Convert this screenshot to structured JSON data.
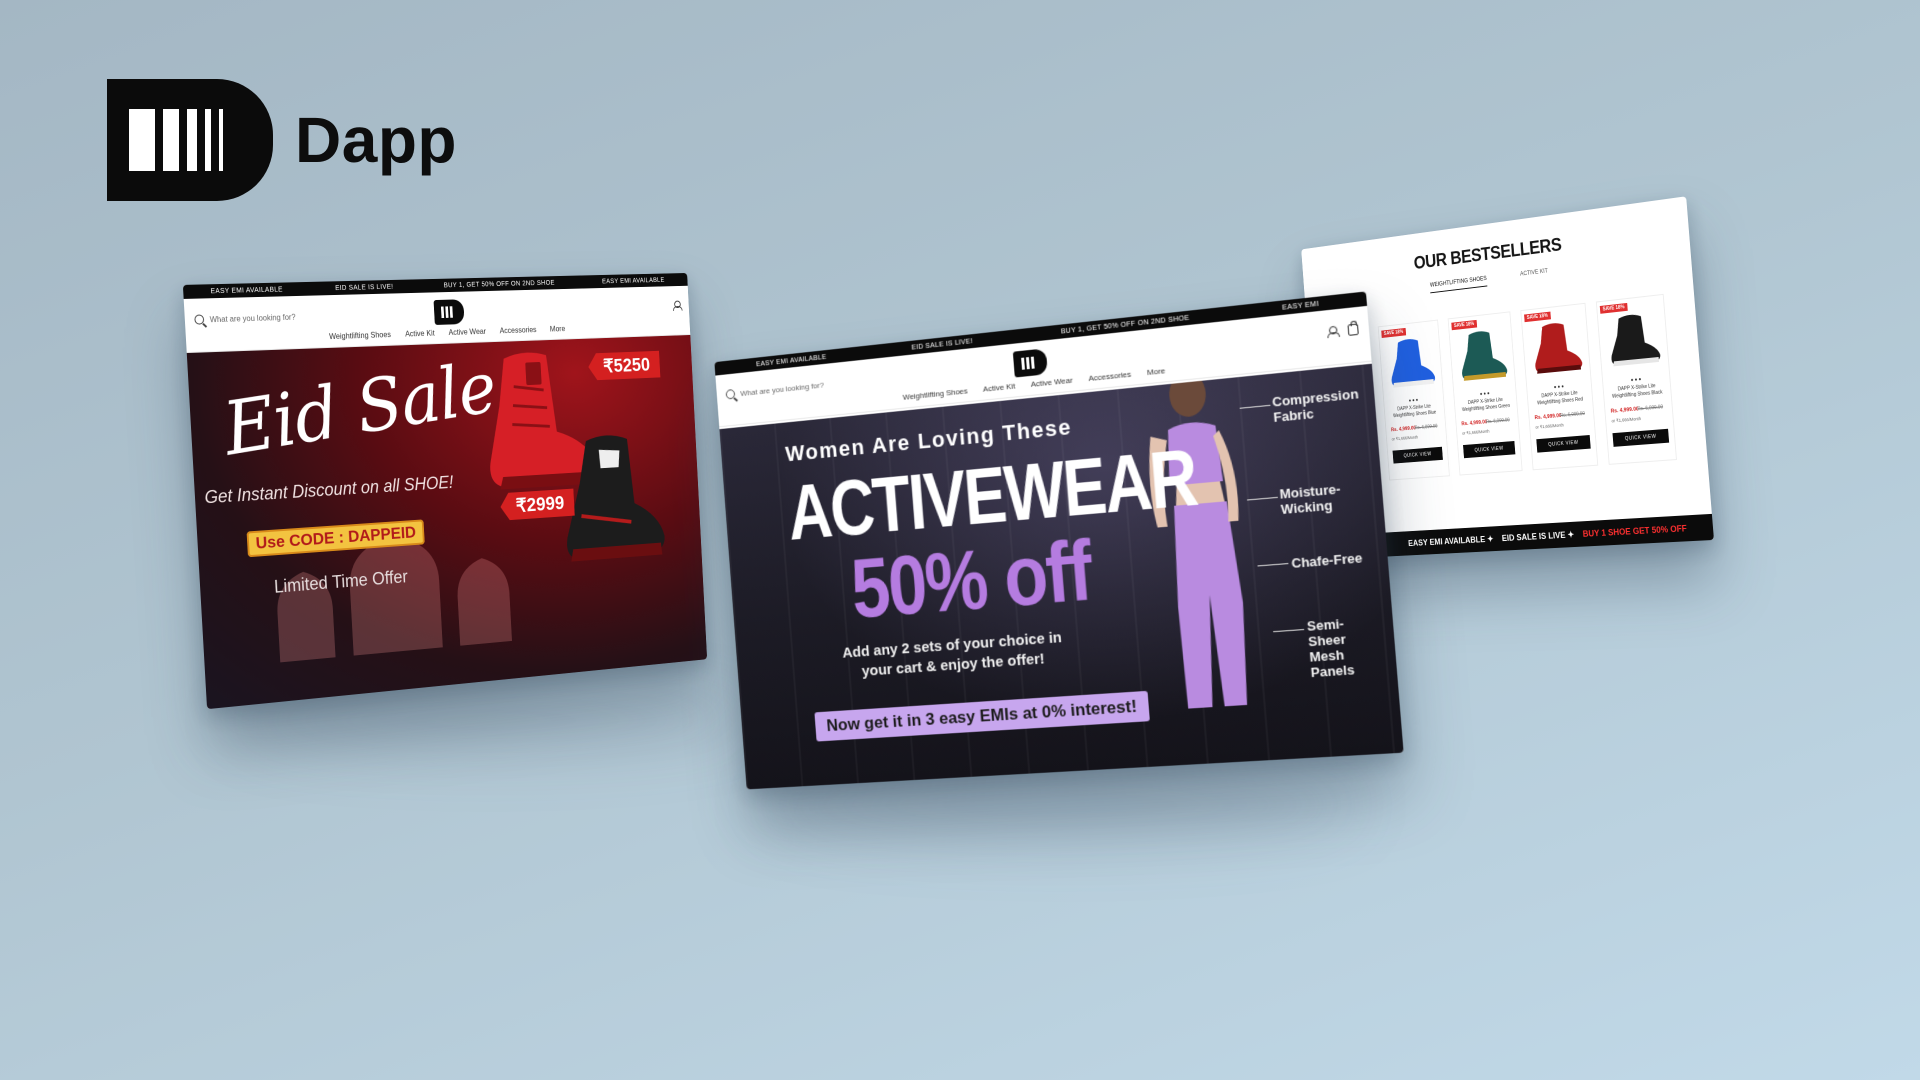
{
  "brand": {
    "name": "Dapp"
  },
  "eid_page": {
    "ticker": [
      "EASY EMI AVAILABLE",
      "EID SALE IS LIVE!",
      "BUY 1, GET 50% OFF ON 2ND SHOE",
      "EASY EMI AVAILABLE"
    ],
    "search_placeholder": "What are you looking for?",
    "nav": [
      "Weightlifting Shoes",
      "Active Kit",
      "Active Wear",
      "Accessories",
      "More"
    ],
    "hero": {
      "title": "Eid Sale",
      "subtitle": "Get Instant Discount on all SHOE!",
      "code": "Use CODE : DAPPEID",
      "offer": "Limited Time Offer",
      "price_high": "₹5250",
      "price_low": "₹2999"
    }
  },
  "activewear_page": {
    "ticker": [
      "EASY EMI AVAILABLE",
      "EID SALE IS LIVE!",
      "BUY 1, GET 50% OFF ON 2ND SHOE",
      "EASY EMI"
    ],
    "search_placeholder": "What are you looking for?",
    "nav": [
      "Weightlifting Shoes",
      "Active Kit",
      "Active Wear",
      "Accessories",
      "More"
    ],
    "hero": {
      "kicker": "Women Are Loving These",
      "title": "ACTIVEWEAR",
      "discount": "50% off",
      "description": "Add any 2 sets of your choice in your cart & enjoy the offer!",
      "emi": "Now get it in 3 easy EMIs at 0% interest!",
      "features": [
        "Compression Fabric",
        "Moisture-Wicking",
        "Chafe-Free",
        "Semi-Sheer Mesh Panels"
      ]
    },
    "cart_count": "0"
  },
  "bestsellers_page": {
    "title": "OUR BESTSELLERS",
    "tabs": [
      "WEIGHTLIFTING SHOES",
      "ACTIVE KIT"
    ],
    "products": [
      {
        "badge": "SAVE 18%",
        "name": "DAPP X-Strike Lite Weightlifting Shoes Blue",
        "price": "Rs. 4,999.00",
        "mrp": "Rs. 6,099.00",
        "emi": "or ₹1,666/Month",
        "button": "QUICK VIEW",
        "color": "#1f5fe0"
      },
      {
        "badge": "SAVE 18%",
        "name": "DAPP X-Strike Lite Weightlifting Shoes Green",
        "price": "Rs. 4,999.00",
        "mrp": "Rs. 6,099.00",
        "emi": "or ₹1,666/Month",
        "button": "QUICK VIEW",
        "color": "#1c5a55"
      },
      {
        "badge": "SAVE 18%",
        "name": "DAPP X-Strike Lite Weightlifting Shoes Red",
        "price": "Rs. 4,999.00",
        "mrp": "Rs. 6,099.00",
        "emi": "or ₹1,666/Month",
        "button": "QUICK VIEW",
        "color": "#b01c1c"
      },
      {
        "badge": "SAVE 18%",
        "name": "DAPP X-Strike Lite Weightlifting Shoes Black",
        "price": "Rs. 4,999.00",
        "mrp": "Rs. 6,099.00",
        "emi": "or ₹1,666/Month",
        "button": "QUICK VIEW",
        "color": "#1a1a1a"
      }
    ],
    "ticker": [
      "EASY EMI AVAILABLE ✦",
      "EID SALE IS LIVE ✦",
      "BUY 1 SHOE GET 50% OFF"
    ]
  },
  "colors": {
    "background": "#b0c5d1",
    "accent_purple": "#b57ce0",
    "accent_red": "#d42020",
    "code_yellow": "#f3c340"
  }
}
